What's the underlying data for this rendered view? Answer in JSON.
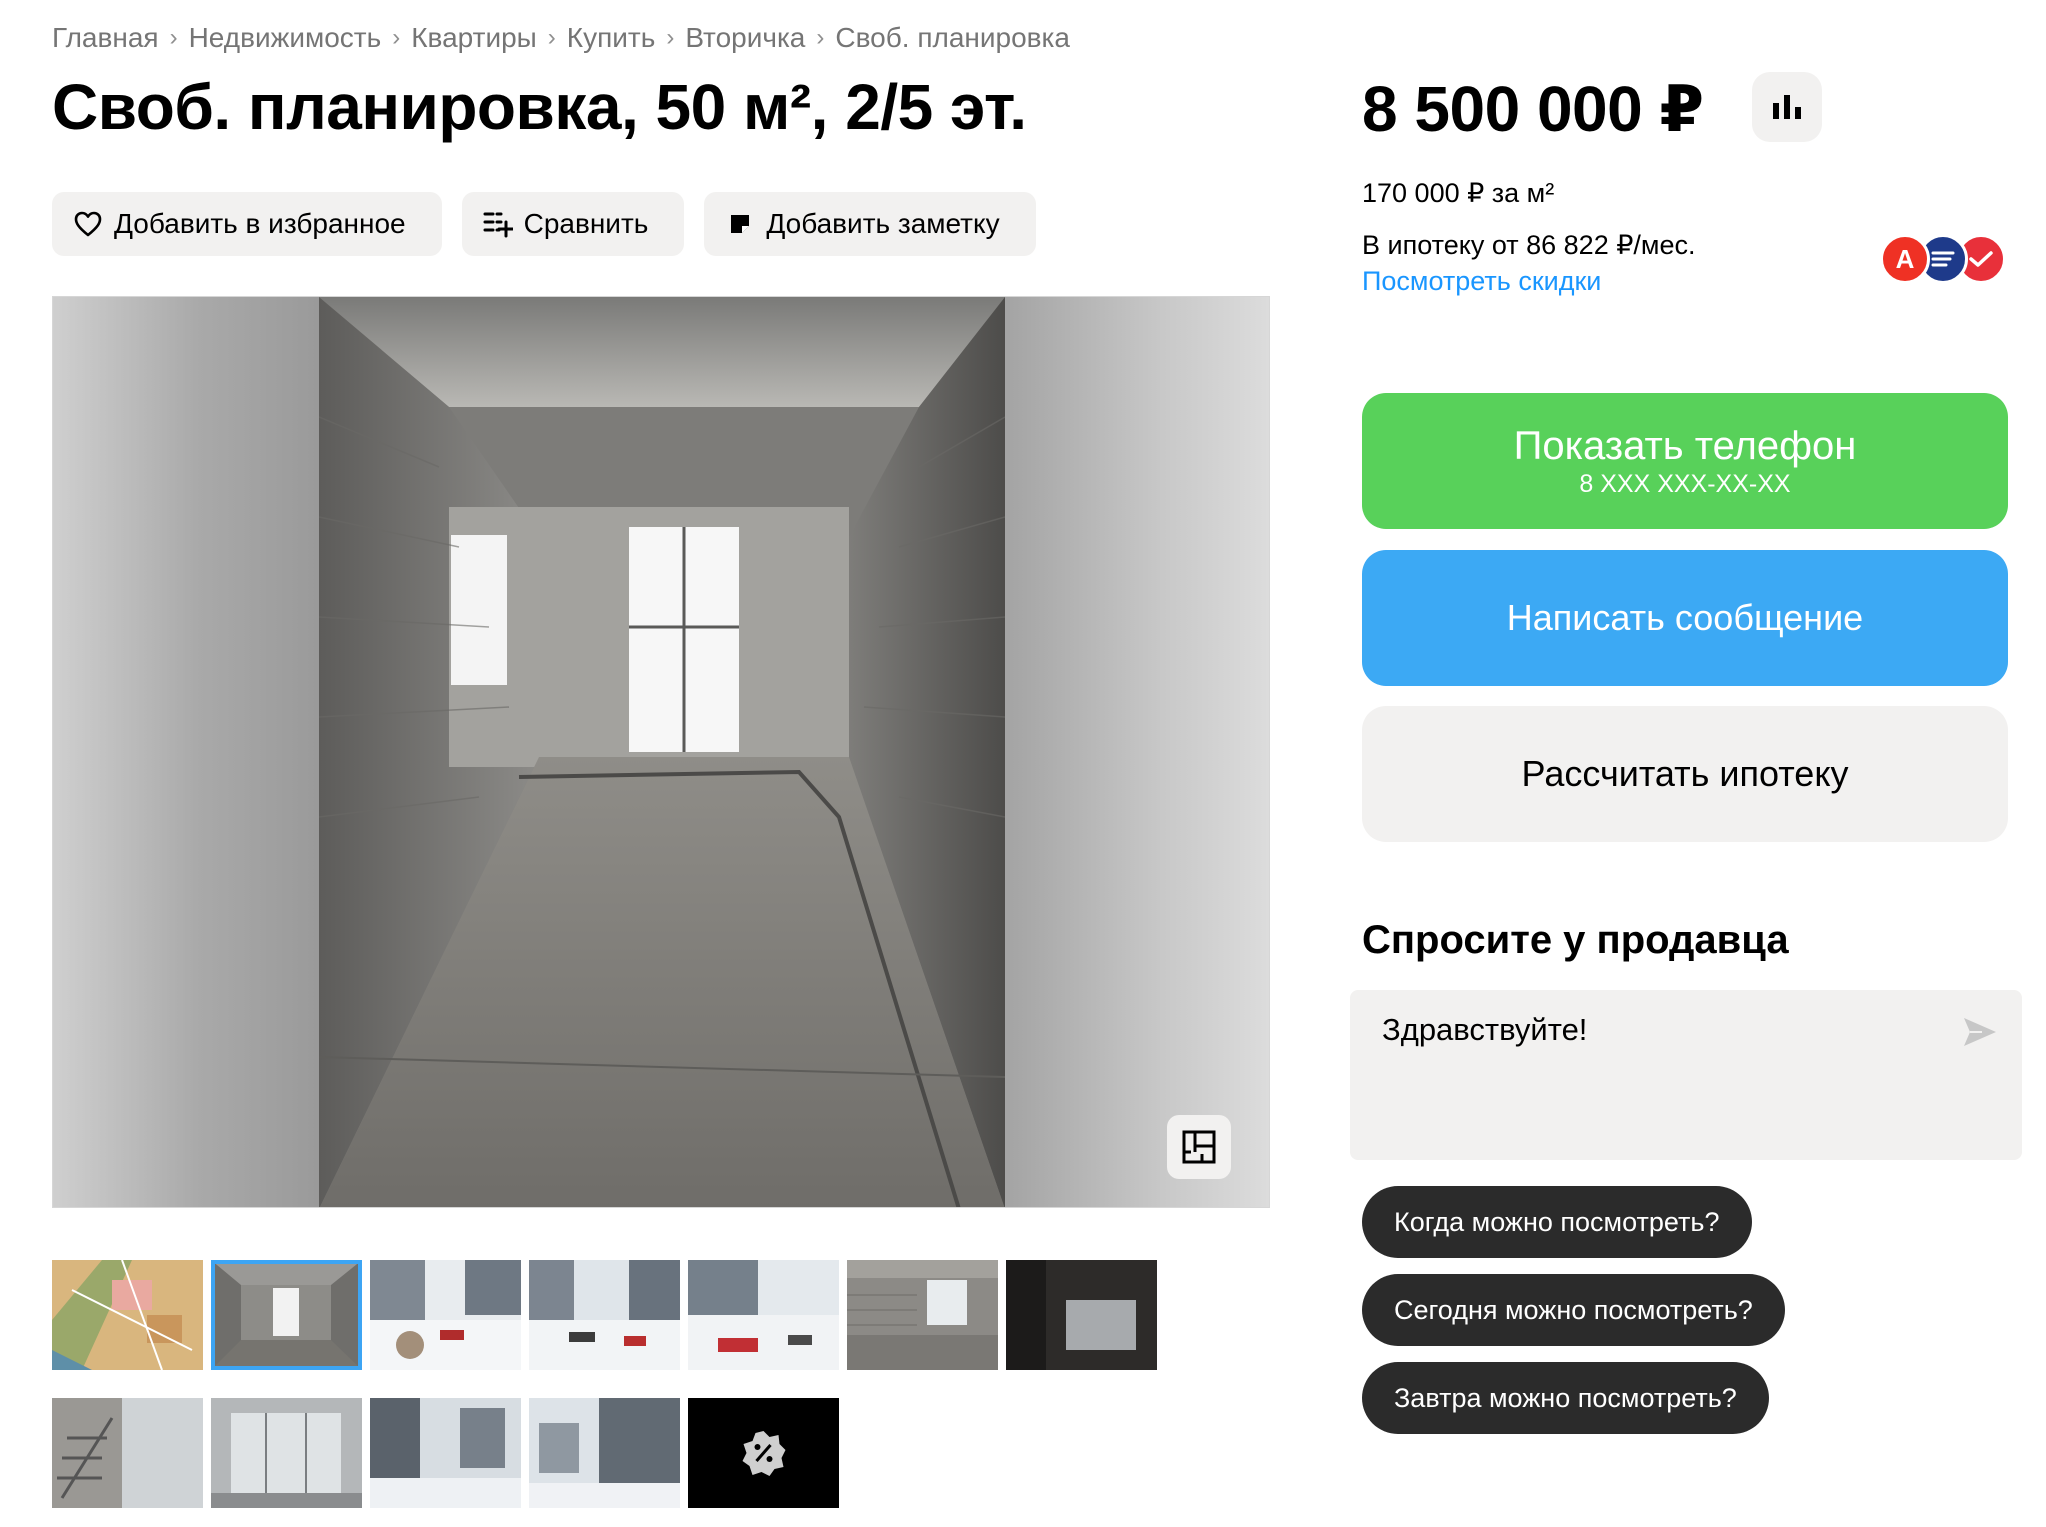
{
  "breadcrumbs": [
    "Главная",
    "Недвижимость",
    "Квартиры",
    "Купить",
    "Вторичка",
    "Своб. планировка"
  ],
  "breadcrumb_separator": "›",
  "title": "Своб. планировка, 50 м², 2/5 эт.",
  "actions": {
    "favorite": "Добавить в избранное",
    "compare": "Сравнить",
    "note": "Добавить заметку"
  },
  "price": {
    "value": "8 500 000 ₽",
    "per_m2": "170 000 ₽ за м²",
    "mortgage_from": "В ипотеку от 86 822 ₽/мес.",
    "discounts_link": "Посмотреть скидки"
  },
  "banks": [
    {
      "name": "alfa-bank-icon",
      "letter": "А",
      "color": "#ef3124"
    },
    {
      "name": "bank-stripes-icon",
      "letter": "",
      "color": "#1e3a8a"
    },
    {
      "name": "bank-check-icon",
      "letter": "",
      "color": "#e8303a"
    }
  ],
  "contact": {
    "show_phone": "Показать телефон",
    "phone_masked": "8 XXX XXX-XX-XX",
    "write_message": "Написать сообщение",
    "calc_mortgage": "Рассчитать ипотеку"
  },
  "ask_seller": {
    "title": "Спросите у продавца",
    "message": "Здравствуйте!",
    "quick_questions": [
      "Когда можно посмотреть?",
      "Сегодня можно посмотреть?",
      "Завтра можно посмотреть?"
    ]
  },
  "gallery": {
    "active_index": 1,
    "thumbnails": [
      "map",
      "interior-window",
      "yard-snow",
      "yard-cars",
      "yard-cars-2",
      "interior-brick",
      "interior-dark",
      "stairs",
      "entrance",
      "buildings-snow",
      "buildings-snow-2",
      "discount"
    ]
  },
  "colors": {
    "accent_green": "#58d15a",
    "accent_blue": "#3ca9f4",
    "link_blue": "#1a96ff",
    "chip_dark": "#2b2b2b",
    "surface": "#f2f1f0"
  }
}
